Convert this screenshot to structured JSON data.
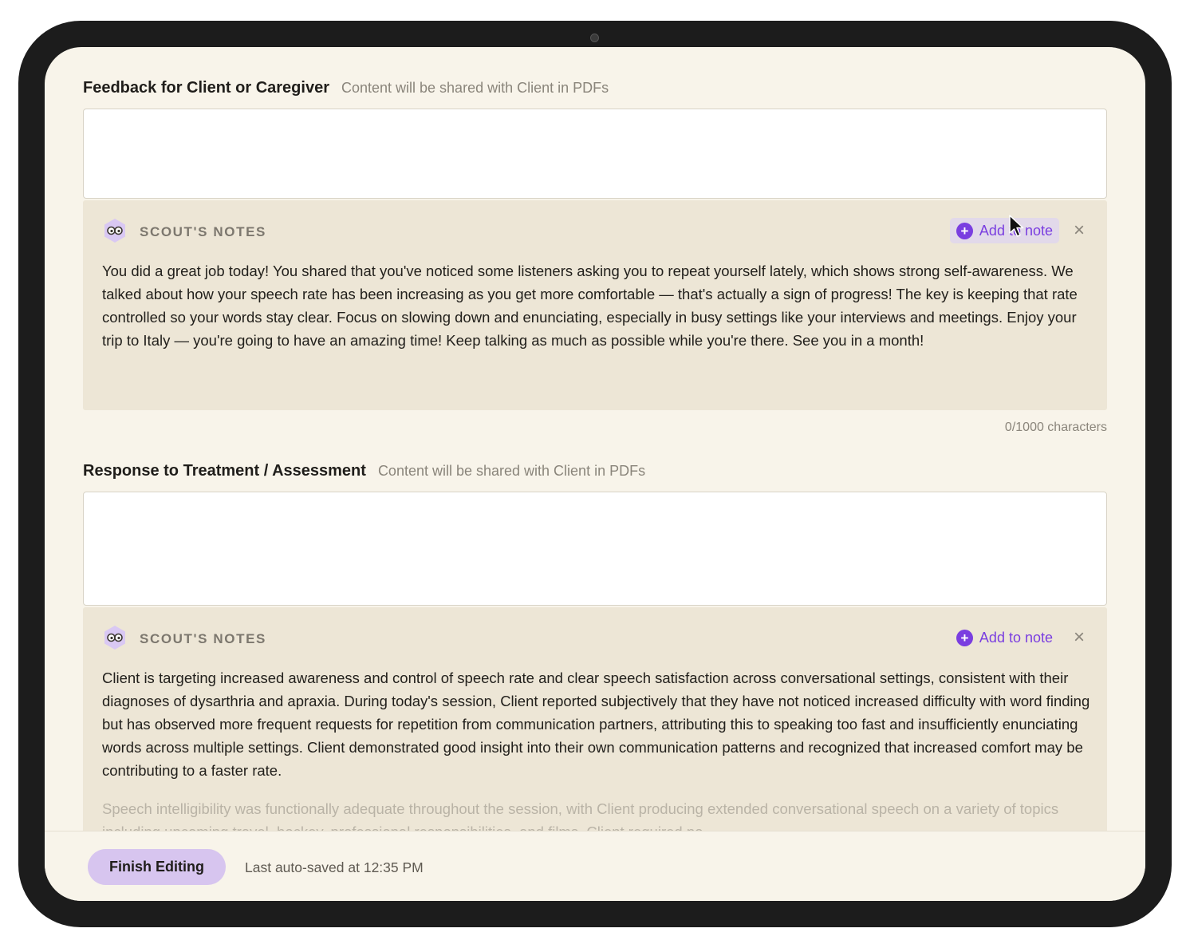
{
  "sections": [
    {
      "title": "Feedback for Client or Caregiver",
      "subtitle": "Content will be shared with Client in PDFs",
      "input_value": "",
      "notes": {
        "title": "SCOUT'S NOTES",
        "add_label": "Add to note",
        "paragraphs": [
          "You did a great job today! You shared that you've noticed some listeners asking you to repeat yourself lately, which shows strong self-awareness. We talked about how your speech rate has been increasing as you get more comfortable — that's actually a sign of progress! The key is keeping that rate controlled so your words stay clear. Focus on slowing down and enunciating, especially in busy settings like your interviews and meetings. Enjoy your trip to Italy — you're going to have an amazing time! Keep talking as much as possible while you're there. See you in a month!"
        ]
      },
      "char_count": "0/1000 characters"
    },
    {
      "title": "Response to Treatment / Assessment",
      "subtitle": "Content will be shared with Client in PDFs",
      "input_value": "",
      "notes": {
        "title": "SCOUT'S NOTES",
        "add_label": "Add to note",
        "paragraphs": [
          "Client is targeting increased awareness and control of speech rate and clear speech satisfaction across conversational settings, consistent with their diagnoses of dysarthria and apraxia. During today's session, Client reported subjectively that they have not noticed increased difficulty with word finding but has observed more frequent requests for repetition from communication partners, attributing this to speaking too fast and insufficiently enunciating words across multiple settings. Client demonstrated good insight into their own communication patterns and recognized that increased comfort may be contributing to a faster rate.",
          "Speech intelligibility was functionally adequate throughout the session, with Client producing extended conversational speech on a variety of topics including upcoming travel, hockey, professional responsibilities, and films. Client required no"
        ]
      }
    }
  ],
  "footer": {
    "finish_label": "Finish Editing",
    "autosave_text": "Last auto-saved at 12:35 PM"
  },
  "colors": {
    "accent": "#7a3ee0",
    "finish_button": "#d7c5ef",
    "screen_bg": "#f8f4ea",
    "notes_bg": "#ede6d6"
  },
  "icons": {
    "logo": "scout-logo-icon",
    "add": "plus-circle-icon",
    "close": "close-icon"
  }
}
